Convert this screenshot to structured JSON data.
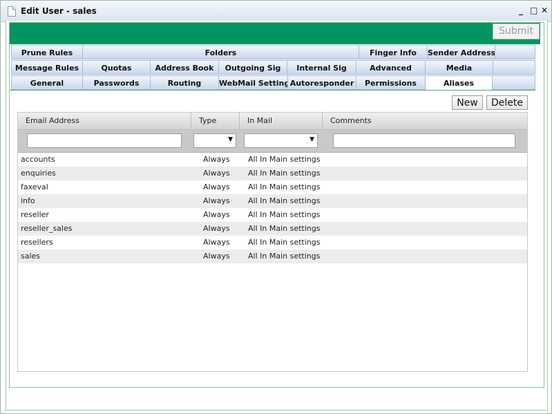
{
  "window": {
    "title": "Edit User - sales",
    "controls": [
      "✕",
      "□",
      "_"
    ]
  },
  "toolbar": {
    "submit_label": "Submit"
  },
  "tabs": {
    "row1": [
      "Prune Rules",
      "Folders",
      "Finger Info",
      "Sender Address"
    ],
    "row2": [
      "Message Rules",
      "Quotas",
      "Address Book",
      "Outgoing Sig",
      "Internal Sig",
      "Advanced",
      "Media"
    ],
    "row3": [
      "General",
      "Passwords",
      "Routing",
      "WebMail Settings",
      "Autoresponder",
      "Permissions",
      "Aliases"
    ],
    "active": "Aliases"
  },
  "actions": {
    "new_label": "New",
    "delete_label": "Delete"
  },
  "grid": {
    "columns": [
      "Email Address",
      "Type",
      "In Mail",
      "Comments"
    ],
    "filters": {
      "email": "",
      "type": "",
      "in_mail": "",
      "comments": ""
    },
    "rows": [
      {
        "email": "accounts",
        "type": "Always",
        "in_mail": "All In Main settings",
        "comments": ""
      },
      {
        "email": "enquiries",
        "type": "Always",
        "in_mail": "All In Main settings",
        "comments": ""
      },
      {
        "email": "faxeval",
        "type": "Always",
        "in_mail": "All In Main settings",
        "comments": ""
      },
      {
        "email": "info",
        "type": "Always",
        "in_mail": "All In Main settings",
        "comments": ""
      },
      {
        "email": "reseller",
        "type": "Always",
        "in_mail": "All In Main settings",
        "comments": ""
      },
      {
        "email": "reseller_sales",
        "type": "Always",
        "in_mail": "All In Main settings",
        "comments": ""
      },
      {
        "email": "resellers",
        "type": "Always",
        "in_mail": "All In Main settings",
        "comments": ""
      },
      {
        "email": "sales",
        "type": "Always",
        "in_mail": "All In Main settings",
        "comments": ""
      }
    ]
  },
  "colors": {
    "brand_green": "#029560",
    "tab_blue": "#c9d8ec",
    "row_alt": "#ececec"
  },
  "icons": {
    "title": "document-icon",
    "select_arrow": "▼"
  }
}
